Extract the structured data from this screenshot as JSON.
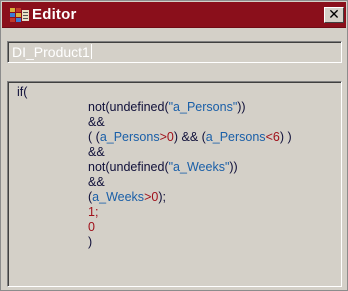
{
  "window": {
    "title": "Editor",
    "close_label": "✕"
  },
  "name_field": {
    "value": "DI_Product1"
  },
  "code": {
    "line1": "if(",
    "line2": {
      "a": "not(undefined(",
      "b": "\"a_Persons\"",
      "c": "))"
    },
    "line3": "&&",
    "line4": {
      "a": "( (",
      "b": "a_Persons",
      "c": ">",
      "d": "0",
      "e": ") && (",
      "f": "a_Persons",
      "g": "<",
      "h": "6",
      "i": ") )"
    },
    "line5": "&&",
    "line6": {
      "a": "not(undefined(",
      "b": "\"a_Weeks\"",
      "c": "))"
    },
    "line7": "&&",
    "line8": {
      "a": "(",
      "b": "a_Weeks",
      "c": ">",
      "d": "0",
      "e": ");"
    },
    "line9": "1;",
    "line10": "0",
    "line11": ")"
  },
  "colors": {
    "titlebar": "#8a0f1b",
    "string": "#1a5fa8",
    "number": "#a0101a",
    "text": "#10103a"
  },
  "icons": {
    "app": "editor-app-icon",
    "close": "close-icon"
  }
}
